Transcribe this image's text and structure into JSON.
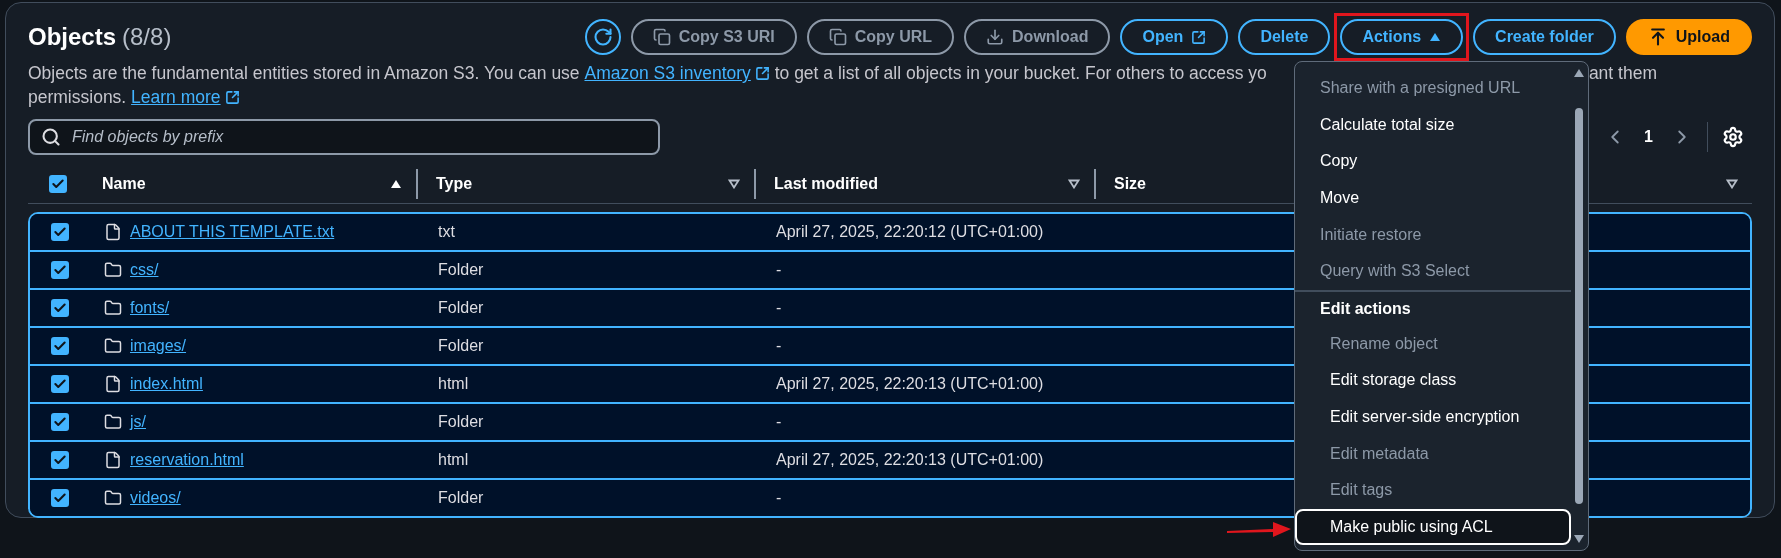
{
  "header": {
    "title": "Objects",
    "count": "(8/8)"
  },
  "toolbar": [
    {
      "kind": "refresh",
      "disabled": false
    },
    {
      "kind": "copy",
      "label": "Copy S3 URI",
      "disabled": true
    },
    {
      "kind": "copy",
      "label": "Copy URL",
      "disabled": true
    },
    {
      "kind": "download",
      "label": "Download",
      "disabled": true
    },
    {
      "kind": "open",
      "label": "Open",
      "disabled": false
    },
    {
      "kind": "plain",
      "label": "Delete",
      "disabled": false
    },
    {
      "kind": "dropdown",
      "label": "Actions",
      "disabled": false,
      "expanded": true,
      "highlighted": true
    },
    {
      "kind": "plain",
      "label": "Create folder",
      "disabled": false
    },
    {
      "kind": "primary",
      "label": "Upload",
      "disabled": false
    }
  ],
  "description": {
    "before": "Objects are the fundamental entities stored in Amazon S3. You can use ",
    "link": "Amazon S3 inventory",
    "after": " to get a list of all objects in your bucket. For others to access yo",
    "right": "ant them",
    "line2": "permissions. ",
    "learn_more": "Learn more"
  },
  "search": {
    "placeholder": "Find objects by prefix"
  },
  "pagination": {
    "page": "1"
  },
  "table": {
    "all_checked": true,
    "columns": [
      {
        "label": "Name",
        "sorted": true
      },
      {
        "label": "Type",
        "sorted": false
      },
      {
        "label": "Last modified",
        "sorted": false
      },
      {
        "label": "Size"
      },
      {
        "sorted": false
      }
    ],
    "rows": [
      {
        "kind": "file",
        "checked": true,
        "name": "ABOUT THIS TEMPLATE.txt",
        "type": "txt",
        "modified": "April 27, 2025, 22:20:12 (UTC+01:00)"
      },
      {
        "kind": "folder",
        "checked": true,
        "name": "css/",
        "type": "Folder",
        "modified": "-"
      },
      {
        "kind": "folder",
        "checked": true,
        "name": "fonts/",
        "type": "Folder",
        "modified": "-"
      },
      {
        "kind": "folder",
        "checked": true,
        "name": "images/",
        "type": "Folder",
        "modified": "-"
      },
      {
        "kind": "file",
        "checked": true,
        "name": "index.html",
        "type": "html",
        "modified": "April 27, 2025, 22:20:13 (UTC+01:00)"
      },
      {
        "kind": "folder",
        "checked": true,
        "name": "js/",
        "type": "Folder",
        "modified": "-"
      },
      {
        "kind": "file",
        "checked": true,
        "name": "reservation.html",
        "type": "html",
        "modified": "April 27, 2025, 22:20:13 (UTC+01:00)"
      },
      {
        "kind": "folder",
        "checked": true,
        "name": "videos/",
        "type": "Folder",
        "modified": "-"
      }
    ]
  },
  "menu": {
    "items": [
      {
        "label": "Share with a presigned URL",
        "disabled": true
      },
      {
        "label": "Calculate total size",
        "disabled": false
      },
      {
        "label": "Copy",
        "disabled": false
      },
      {
        "label": "Move",
        "disabled": false
      },
      {
        "label": "Initiate restore",
        "disabled": true
      },
      {
        "label": "Query with S3 Select",
        "disabled": true
      },
      {
        "label": "Edit actions",
        "children": [
          {
            "label": "Rename object",
            "disabled": true
          },
          {
            "label": "Edit storage class",
            "disabled": false
          },
          {
            "label": "Edit server-side encryption",
            "disabled": false
          },
          {
            "label": "Edit metadata",
            "disabled": true
          },
          {
            "label": "Edit tags",
            "disabled": true
          },
          {
            "label": "Make public using ACL",
            "disabled": false,
            "focused": true,
            "annotated": true
          }
        ]
      }
    ]
  }
}
